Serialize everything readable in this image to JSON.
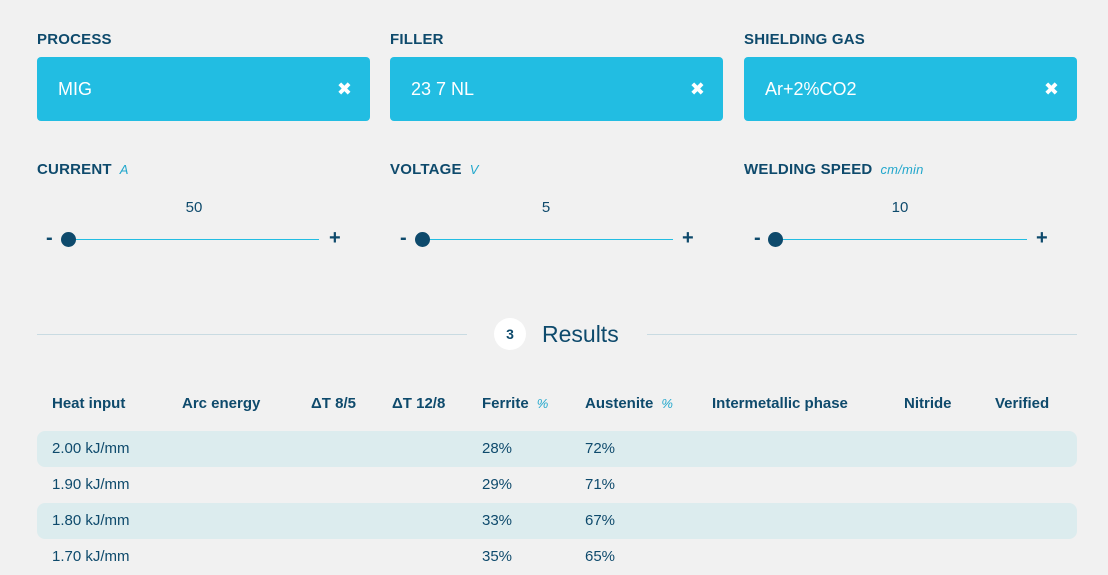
{
  "inputs": {
    "process": {
      "label": "PROCESS",
      "value": "MIG"
    },
    "filler": {
      "label": "FILLER",
      "value": "23 7 NL"
    },
    "gas": {
      "label": "SHIELDING GAS",
      "value": "Ar+2%CO2"
    },
    "clear_icon": "✖"
  },
  "sliders": {
    "current": {
      "label": "CURRENT",
      "unit": "A",
      "value": "50"
    },
    "voltage": {
      "label": "VOLTAGE",
      "unit": "V",
      "value": "5"
    },
    "speed": {
      "label": "WELDING SPEED",
      "unit": "cm/min",
      "value": "10"
    },
    "minus": "-",
    "plus": "+"
  },
  "results": {
    "step": "3",
    "title": "Results",
    "columns": {
      "heat_input": "Heat input",
      "arc_energy": "Arc energy",
      "dt85": "ΔT 8/5",
      "dt128": "ΔT 12/8",
      "ferrite": "Ferrite",
      "ferrite_unit": "%",
      "austenite": "Austenite",
      "austenite_unit": "%",
      "intermetallic": "Intermetallic phase",
      "nitride": "Nitride",
      "verified": "Verified"
    },
    "rows": [
      {
        "heat_input": "2.00 kJ/mm",
        "ferrite": "28%",
        "austenite": "72%"
      },
      {
        "heat_input": "1.90 kJ/mm",
        "ferrite": "29%",
        "austenite": "71%"
      },
      {
        "heat_input": "1.80 kJ/mm",
        "ferrite": "33%",
        "austenite": "67%"
      },
      {
        "heat_input": "1.70 kJ/mm",
        "ferrite": "35%",
        "austenite": "65%"
      }
    ]
  }
}
